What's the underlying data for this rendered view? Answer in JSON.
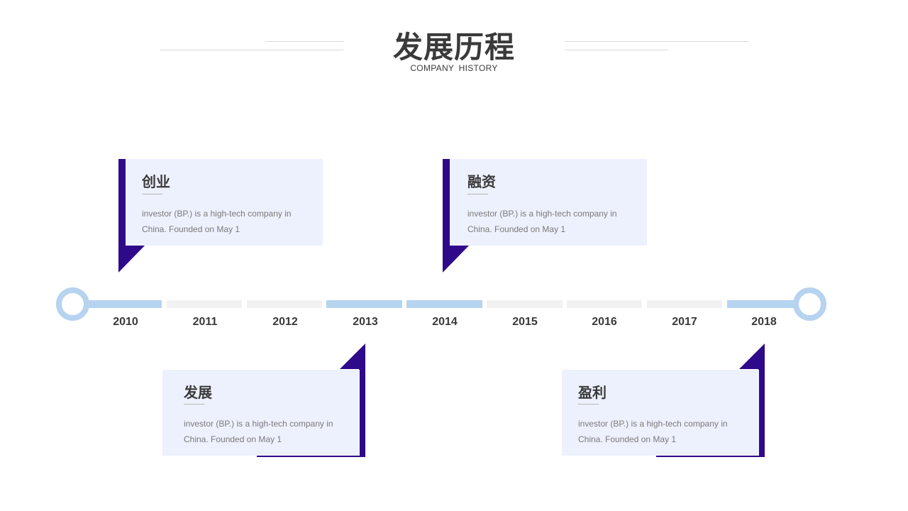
{
  "header": {
    "title": "发展历程",
    "subtitle": "COMPANY HISTORY"
  },
  "colors": {
    "accent": "#2e0a8a",
    "card_bg": "#edf1fd",
    "timeline_active": "#b6d3ef",
    "timeline_inactive": "#f2f2f2",
    "text_dark": "#3a3a3a",
    "text_muted": "#7a7a7a"
  },
  "timeline": {
    "years": [
      "2010",
      "2011",
      "2012",
      "2013",
      "2014",
      "2015",
      "2016",
      "2017",
      "2018"
    ],
    "highlighted_segments": [
      "2010",
      "2013",
      "2014",
      "2018"
    ]
  },
  "milestones": [
    {
      "title": "创业",
      "text": "investor (BP.) is a high-tech company in China. Founded on May 1"
    },
    {
      "title": "融资",
      "text": "investor (BP.) is a high-tech company in China. Founded on May 1"
    },
    {
      "title": "发展",
      "text": "investor (BP.) is a high-tech company in China. Founded on May 1"
    },
    {
      "title": "盈利",
      "text": "investor (BP.) is a high-tech company in China. Founded on May 1"
    }
  ]
}
